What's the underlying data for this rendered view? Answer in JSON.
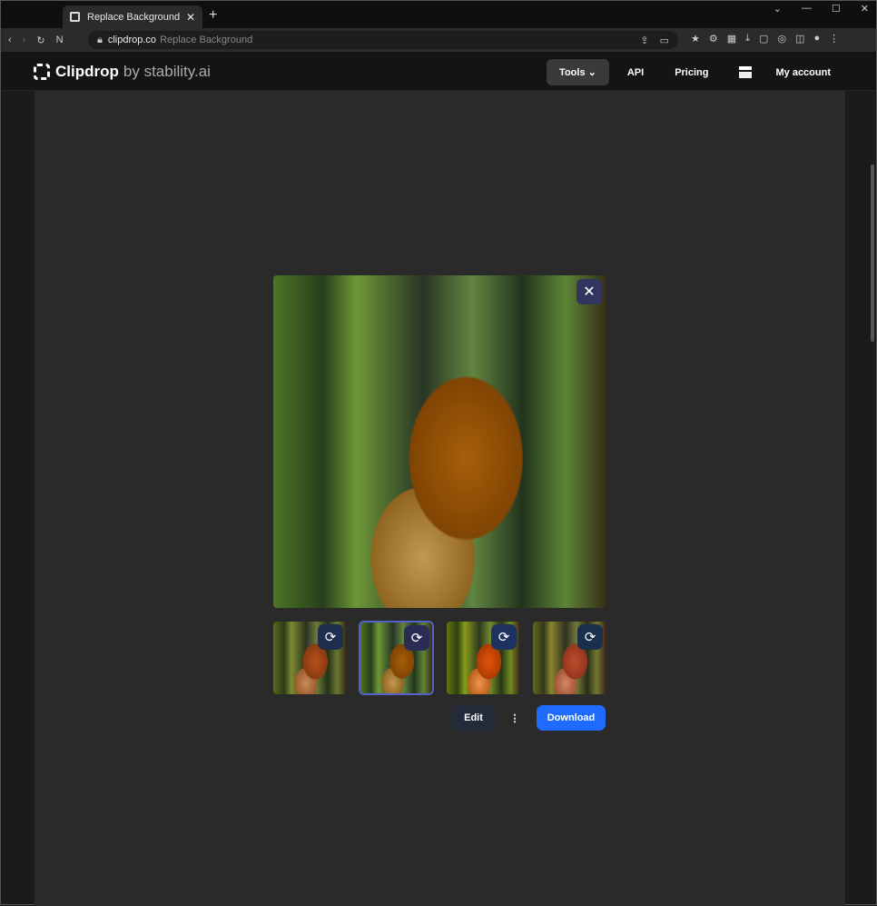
{
  "browser": {
    "tab_title": "Replace Background",
    "url_host": "clipdrop.co",
    "url_path": "Replace Background"
  },
  "site": {
    "logo": "Clipdrop",
    "logo_by": "by stability.ai",
    "nav": {
      "tools": "Tools",
      "api": "API",
      "pricing": "Pricing",
      "account": "My account"
    }
  },
  "editor": {
    "edit": "Edit",
    "download": "Download",
    "more": "⋮",
    "selected_variant": 2
  },
  "colors": {
    "accent": "#1f6bff",
    "icon_button": "#1f2d4f"
  }
}
